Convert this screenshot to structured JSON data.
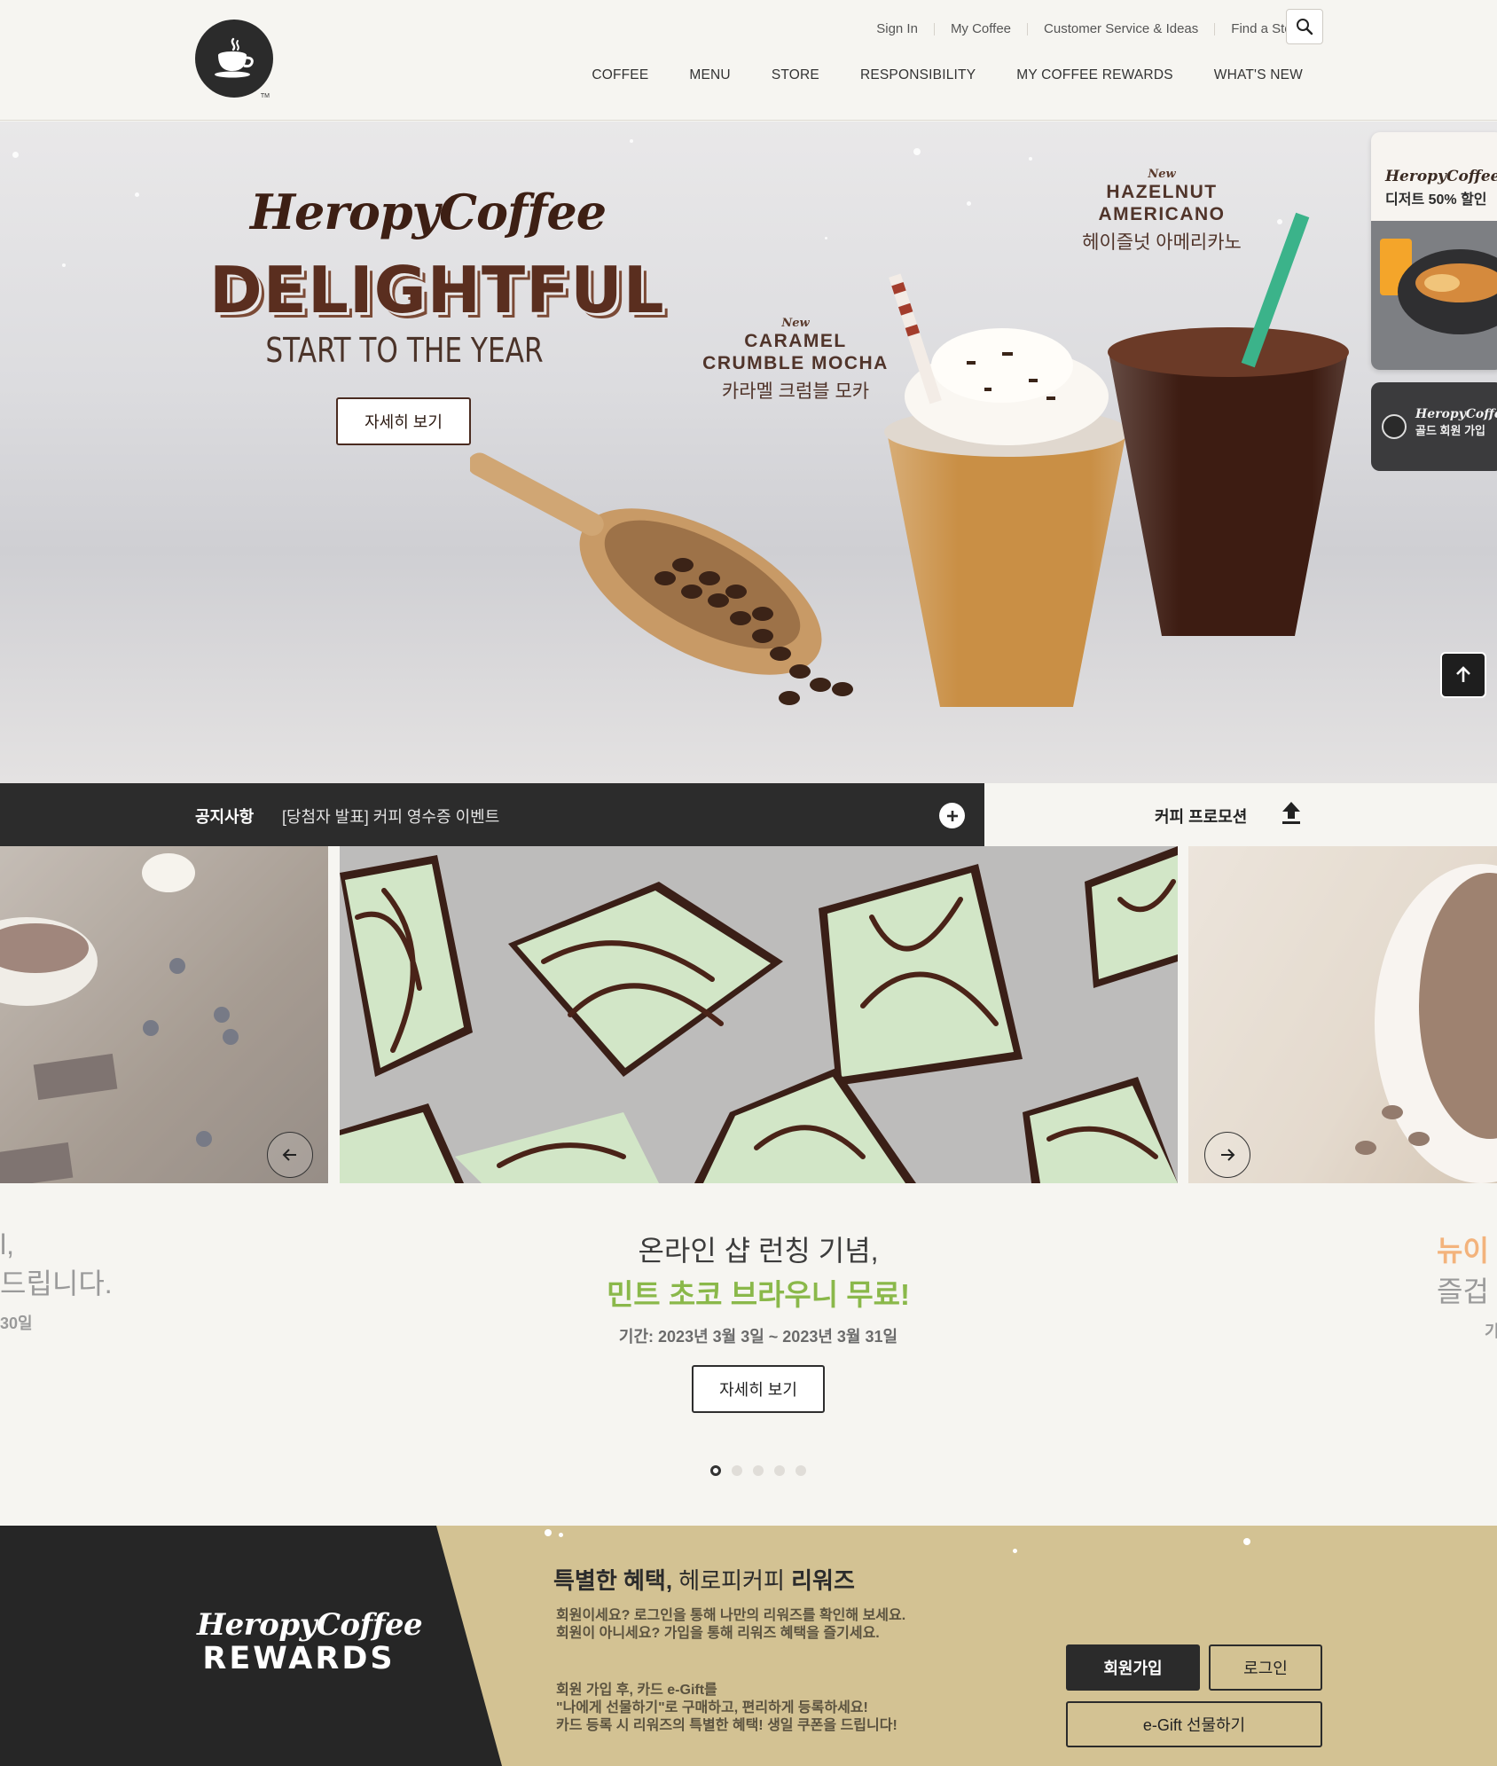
{
  "header": {
    "util_links": [
      "Sign In",
      "My Coffee",
      "Customer Service & Ideas",
      "Find a Store"
    ],
    "main_nav": [
      "COFFEE",
      "MENU",
      "STORE",
      "RESPONSIBILITY",
      "MY COFFEE REWARDS",
      "WHAT'S NEW"
    ],
    "logo_tm": "TM"
  },
  "hero": {
    "brand": "HeropyCoffee",
    "title": "DELIGHTFUL",
    "subtitle": "START TO THE YEAR",
    "button": "자세히 보기",
    "product1": {
      "new": "New",
      "en1": "CARAMEL",
      "en2": "CRUMBLE MOCHA",
      "ko": "카라멜 크럼블 모카"
    },
    "product2": {
      "new": "New",
      "en1": "HAZELNUT",
      "en2": "AMERICANO",
      "ko": "헤이즐넛 아메리카노"
    },
    "side_dessert": {
      "brand": "HeropyCoffee",
      "text": "디저트 50% 할인"
    },
    "side_gold": {
      "brand": "HeropyCoffee",
      "text": "골드 회원 가입"
    }
  },
  "notice": {
    "label": "공지사항",
    "text": "[당첨자 발표] 커피 영수증 이벤트",
    "promo_label": "커피 프로모션"
  },
  "slider": {
    "line1": "온라인 샵 런칭 기념,",
    "line2": "민트 초코 브라우니 무료!",
    "period": "기간: 2023년 3월 3일 ~ 2023년 3월 31일",
    "button": "자세히 보기",
    "left_fragment": {
      "l1": "l,",
      "l2": "드립니다.",
      "l3": "30일"
    },
    "right_fragment": {
      "l1": "뉴이",
      "l2": "즐겁",
      "l3": "기"
    },
    "dot_count": 5,
    "active_dot": 1
  },
  "rewards": {
    "brand": "HeropyCoffee",
    "title": "REWARDS",
    "head_bold1": "특별한 혜택,",
    "head_normal": " 헤로피커피 ",
    "head_bold2": "리워즈",
    "desc1": "회원이세요? 로그인을 통해 나만의 리워즈를 확인해 보세요.",
    "desc2": "회원이 아니세요? 가입을 통해 리워즈 혜택을 즐기세요.",
    "desc3": "회원 가입 후, 카드 e-Gift를",
    "desc4": "\"나에게 선물하기\"로 구매하고, 편리하게 등록하세요!",
    "desc5": "카드 등록 시 리워즈의 특별한 혜택! 생일 쿠폰을 드립니다!",
    "join_button": "회원가입",
    "login_button": "로그인",
    "gift_button": "e-Gift 선물하기"
  },
  "colors": {
    "accent_green": "#8ab84a",
    "dark": "#2c2c2c",
    "gold": "#d3c293",
    "brown": "#5a2e1f"
  }
}
